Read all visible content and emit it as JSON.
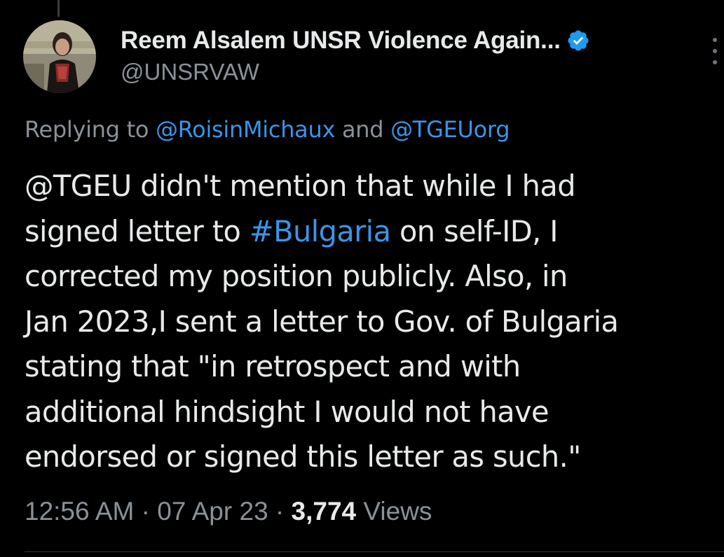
{
  "author": {
    "display_name": "Reem Alsalem UNSR Violence Again...",
    "handle": "@UNSRVAW",
    "verified": true,
    "avatar_icon": "profile-photo"
  },
  "reply": {
    "prefix": "Replying to ",
    "mention_1": "@RoisinMichaux",
    "joiner": " and ",
    "mention_2": "@TGEUorg"
  },
  "tweet": {
    "line_1": "@TGEU didn't mention that while I had",
    "line_2_pre": "signed letter to ",
    "line_2_hashtag": "#Bulgaria",
    "line_2_post": " on self-ID, I",
    "line_3": "corrected my position publicly. Also, in",
    "line_4": "Jan 2023,I sent a letter to Gov. of Bulgaria",
    "line_5": "stating that \"in retrospect and with",
    "line_6": "additional hindsight I would not have",
    "line_7": "endorsed or signed this letter as such.\""
  },
  "meta": {
    "time": "12:56 AM",
    "separator": " · ",
    "date": "07 Apr 23",
    "views_count": "3,774",
    "views_label": " Views"
  },
  "colors": {
    "background": "#000000",
    "text": "#e7e9ea",
    "secondary": "#8b9198",
    "link": "#3a95e8",
    "verified_badge": "#1d9bf0"
  }
}
